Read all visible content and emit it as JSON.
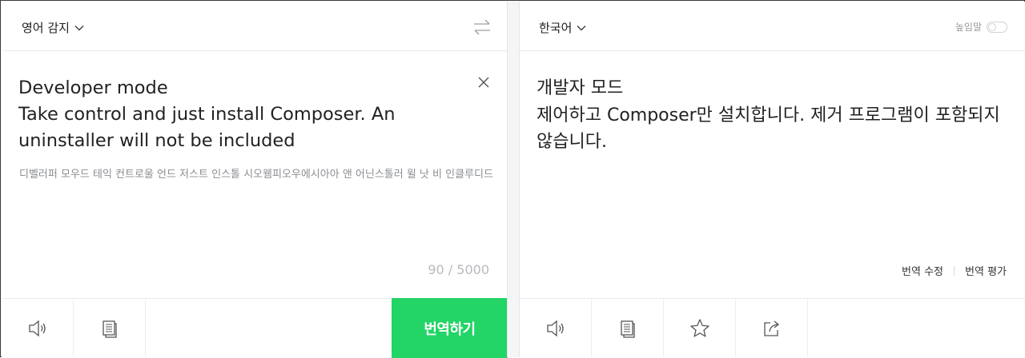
{
  "source_panel": {
    "language_label": "영어 감지",
    "text": "Developer mode\nTake control and just install Composer. An uninstaller will not be included",
    "pronunciation": "디벨러퍼 모우드 테익 컨트로울 언드 저스트 인스톨 시오웸피오우에시아아 앤 어닌스톨러 윌 낫 비 인클루디드",
    "char_count": "90 / 5000",
    "translate_button_label": "번역하기"
  },
  "target_panel": {
    "language_label": "한국어",
    "honorific_label": "높임말",
    "honorific_enabled": false,
    "text": "개발자 모드\n제어하고 Composer만 설치합니다. 제거 프로그램이 포함되지 않습니다.",
    "edit_translation_label": "번역 수정",
    "rate_translation_label": "번역 평가"
  },
  "icons": {
    "swap": "swap-arrows-icon",
    "clear": "close-icon",
    "speak": "speaker-icon",
    "copy": "copy-icon",
    "favorite": "star-icon",
    "share": "share-icon",
    "dropdown": "chevron-down-icon"
  },
  "colors": {
    "accent": "#23d466",
    "border": "#3a3a3a",
    "muted_text": "#8a8d91"
  }
}
